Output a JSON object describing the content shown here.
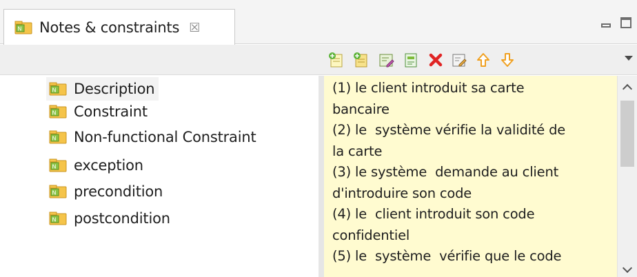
{
  "tab": {
    "title": "Notes & constraints",
    "close_glyph": "☒",
    "icon": "notes-folder-icon"
  },
  "window_controls": [
    "minimize-icon",
    "maximize-icon"
  ],
  "toolbar": {
    "buttons": [
      {
        "name": "add-note-icon"
      },
      {
        "name": "add-constraint-icon"
      },
      {
        "name": "edit-note-icon"
      },
      {
        "name": "new-category-icon"
      },
      {
        "name": "delete-icon"
      },
      {
        "name": "edit-properties-icon"
      },
      {
        "name": "move-up-icon"
      },
      {
        "name": "move-down-icon"
      }
    ],
    "overflow": "view-menu-icon"
  },
  "tree": {
    "items": [
      {
        "label": "Description",
        "selected": true
      },
      {
        "label": "Constraint"
      },
      {
        "label": "Non-functional Constraint"
      },
      {
        "label": "exception"
      },
      {
        "label": "precondition"
      },
      {
        "label": "postcondition"
      }
    ]
  },
  "text": {
    "content": "(1) le client introduit sa carte\nbancaire\n(2) le  système vérifie la validité de\nla carte\n(3) le système  demande au client\nd'introduire son code\n(4) le  client introduit son code\nconfidentiel\n(5) le  système  vérifie que le code"
  },
  "colors": {
    "text_background": "#fffbd0",
    "icon_folder": "#f5c44a",
    "icon_badge": "#7dbb3a",
    "delete_red": "#e02424",
    "arrow_orange": "#f0a020"
  }
}
